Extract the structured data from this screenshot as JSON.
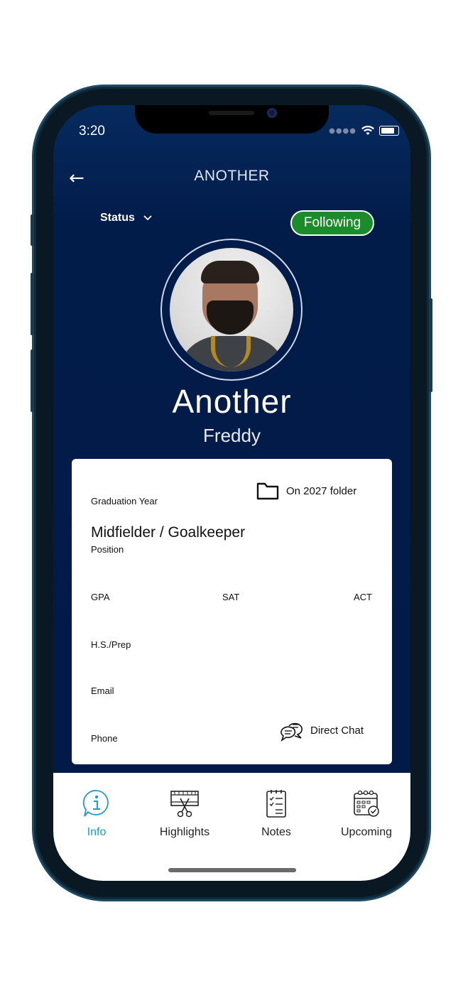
{
  "status_bar": {
    "time": "3:20"
  },
  "nav": {
    "title": "ANOTHER"
  },
  "status_dropdown": {
    "label": "Status"
  },
  "follow_button": {
    "label": "Following",
    "color": "#1b8c2a"
  },
  "profile": {
    "first_name": "Another",
    "last_name": "Freddy"
  },
  "card": {
    "graduation_year_label": "Graduation Year",
    "folder_text": "On 2027 folder",
    "position_value": "Midfielder / Goalkeeper",
    "position_label": "Position",
    "gpa_label": "GPA",
    "sat_label": "SAT",
    "act_label": "ACT",
    "hs_label": "H.S./Prep",
    "email_label": "Email",
    "phone_label": "Phone",
    "chat_label": "Direct Chat"
  },
  "tabs": [
    {
      "label": "Info",
      "icon": "info-icon",
      "active": true
    },
    {
      "label": "Highlights",
      "icon": "film-scissors-icon",
      "active": false
    },
    {
      "label": "Notes",
      "icon": "checklist-icon",
      "active": false
    },
    {
      "label": "Upcoming",
      "icon": "calendar-check-icon",
      "active": false
    }
  ],
  "colors": {
    "background": "#011a48",
    "accent": "#1e9ad0"
  }
}
